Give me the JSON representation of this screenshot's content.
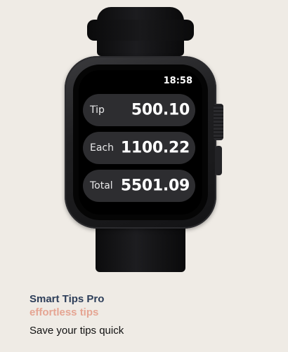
{
  "watch": {
    "time": "18:58",
    "rows": [
      {
        "label": "Tip",
        "value": "500.10"
      },
      {
        "label": "Each",
        "value": "1100.22"
      },
      {
        "label": "Total",
        "value": "5501.09"
      }
    ]
  },
  "caption": {
    "app_name": "Smart Tips Pro",
    "tagline": "effortless tips",
    "description": "Save your tips quick"
  },
  "colors": {
    "background": "#efebe5",
    "app_name": "#2d3e59",
    "tagline": "#e5a593",
    "pill": "#2d2d30"
  }
}
